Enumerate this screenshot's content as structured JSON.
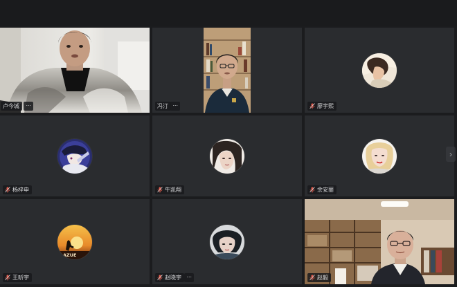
{
  "meeting": {
    "participants": [
      {
        "name": "卢今城",
        "video": "on"
      },
      {
        "name": "冯汀",
        "video": "on"
      },
      {
        "name": "廖宇熙",
        "video": "off"
      },
      {
        "name": "杨梓申",
        "video": "off"
      },
      {
        "name": "牛凯翔",
        "video": "off"
      },
      {
        "name": "余安丽",
        "video": "off"
      },
      {
        "name": "王昕宇",
        "video": "off"
      },
      {
        "name": "赵晓宇",
        "video": "off"
      },
      {
        "name": "赵毅",
        "video": "on"
      }
    ],
    "more_label": "···",
    "next_page_label": "›",
    "avatar_badge_text": "AZUE"
  },
  "colors": {
    "background": "#1b1c1e",
    "tile": "#2a2c2f",
    "nameplate": "#191a1c"
  }
}
